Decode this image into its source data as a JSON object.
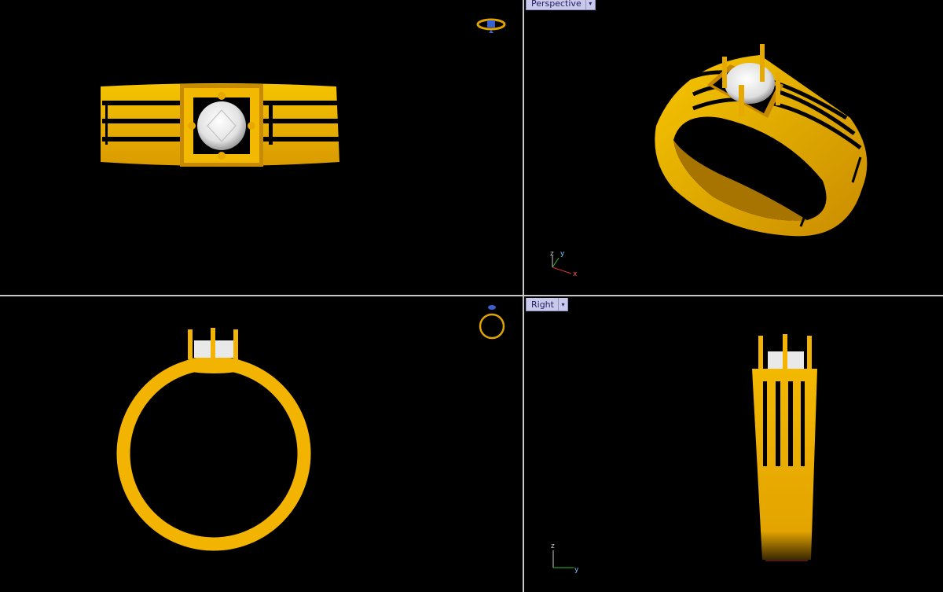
{
  "viewports": {
    "perspective": {
      "title": "Perspective",
      "dropdown": "▾"
    },
    "right": {
      "title": "Right",
      "dropdown": "▾"
    }
  },
  "axes": {
    "perspective": {
      "x": "x",
      "y": "y",
      "z": "z"
    },
    "right": {
      "y": "y",
      "z": "z"
    }
  },
  "colors": {
    "background": "#000000",
    "gold": "#f3b400",
    "gold_dark": "#b57f00",
    "gem": "#e8e8e8",
    "viewport_tab": "#c9c9ec",
    "divider": "#c8c8c8"
  }
}
